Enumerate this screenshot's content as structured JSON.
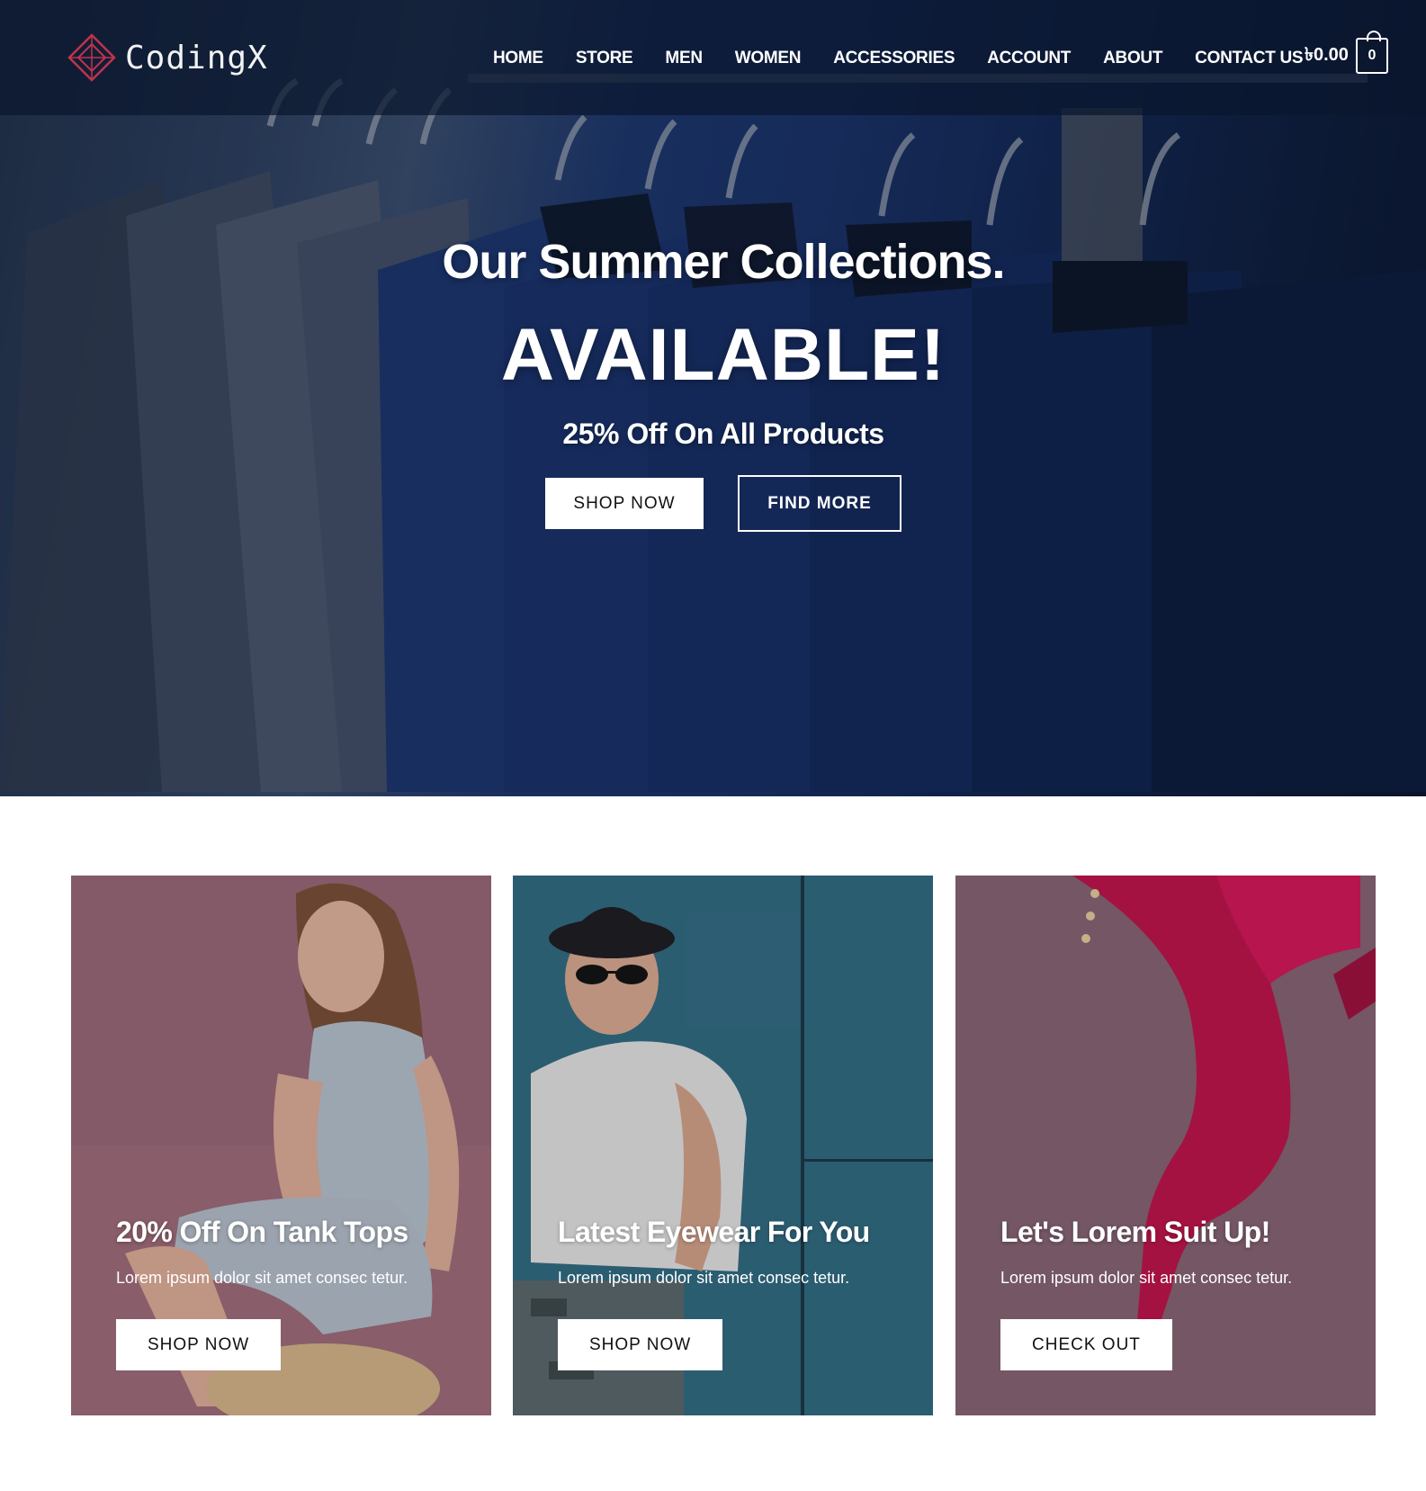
{
  "brand": {
    "name": "CodingX",
    "accent": "#c0334d"
  },
  "nav": {
    "items": [
      "HOME",
      "STORE",
      "MEN",
      "WOMEN",
      "ACCESSORIES",
      "ACCOUNT",
      "ABOUT",
      "CONTACT US"
    ]
  },
  "cart": {
    "total": "৳0.00",
    "count": "0"
  },
  "hero": {
    "heading": "Our Summer Collections.",
    "title": "AVAILABLE!",
    "subtitle": "25% Off On All Products",
    "primary_button": "SHOP NOW",
    "secondary_button": "FIND MORE"
  },
  "cards": [
    {
      "title": "20% Off On Tank Tops",
      "description": "Lorem ipsum dolor sit amet consec tetur.",
      "button": "SHOP NOW"
    },
    {
      "title": "Latest Eyewear For You",
      "description": "Lorem ipsum dolor sit amet consec tetur.",
      "button": "SHOP NOW"
    },
    {
      "title": "Let's Lorem Suit Up!",
      "description": "Lorem ipsum dolor sit amet consec tetur.",
      "button": "CHECK OUT"
    }
  ]
}
